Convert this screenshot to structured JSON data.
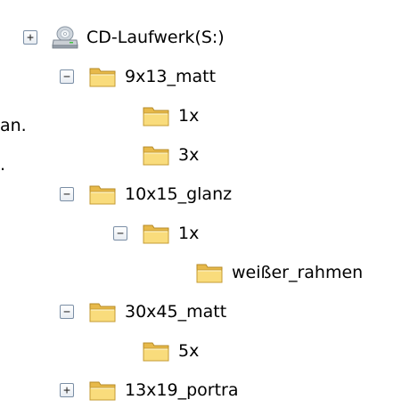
{
  "left_fragments": [
    "an.",
    "."
  ],
  "tree": {
    "items": [
      {
        "label": "CD-Laufwerk(S:)",
        "expander": "+",
        "icon": "cd-drive-icon"
      },
      {
        "label": "9x13_matt",
        "expander": "−",
        "icon": "folder-icon"
      },
      {
        "label": "1x",
        "expander": "",
        "icon": "folder-icon"
      },
      {
        "label": "3x",
        "expander": "",
        "icon": "folder-icon"
      },
      {
        "label": "10x15_glanz",
        "expander": "−",
        "icon": "folder-icon"
      },
      {
        "label": "1x",
        "expander": "−",
        "icon": "folder-icon"
      },
      {
        "label": "weißer_rahmen",
        "expander": "",
        "icon": "folder-icon"
      },
      {
        "label": "30x45_matt",
        "expander": "−",
        "icon": "folder-icon"
      },
      {
        "label": "5x",
        "expander": "",
        "icon": "folder-icon"
      },
      {
        "label": "13x19_portra",
        "expander": "+",
        "icon": "folder-icon"
      }
    ]
  }
}
